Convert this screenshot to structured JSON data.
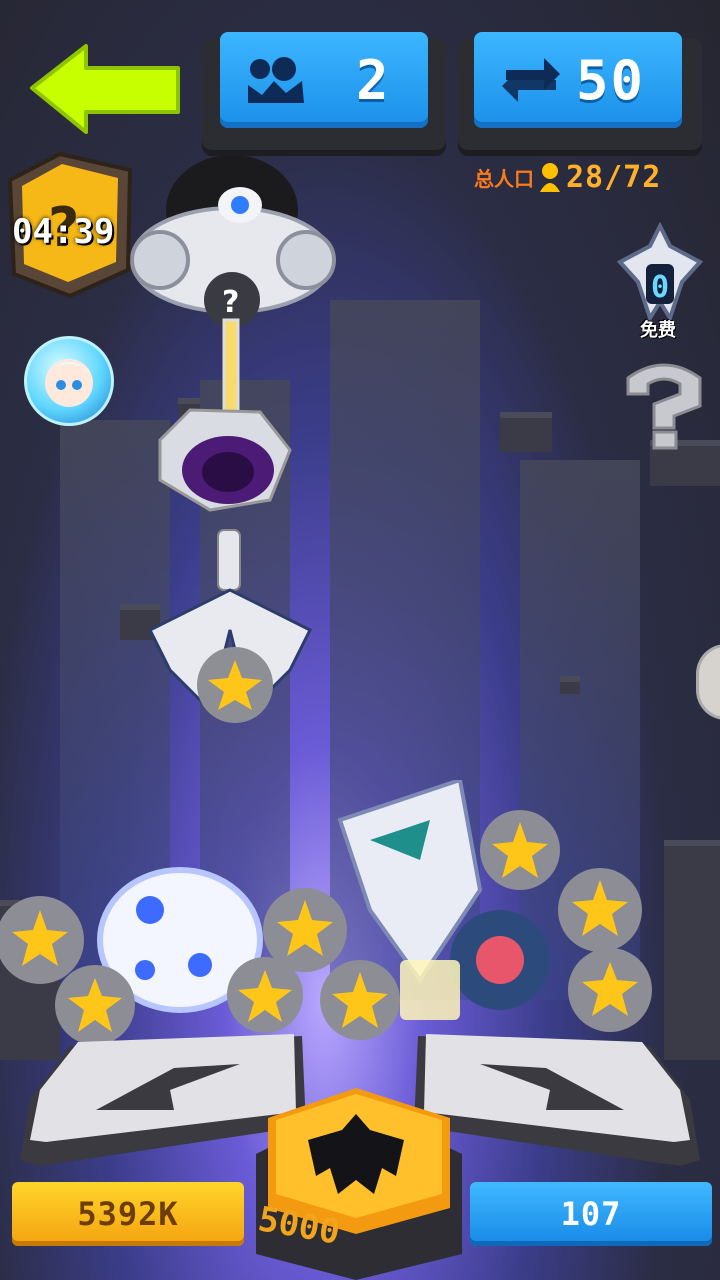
{
  "header": {
    "back_icon": "arrow-left-icon",
    "cats": {
      "icon": "paw-icon",
      "value": "2"
    },
    "refresh": {
      "icon": "swap-arrows-icon",
      "value": "50"
    }
  },
  "population": {
    "label": "总人口",
    "icon": "person-icon",
    "value": "28/72"
  },
  "event": {
    "icon": "mystery-box-icon",
    "timer": "04:39"
  },
  "free_claw": {
    "count": "0",
    "label": "免费"
  },
  "controls": {
    "left_icon": "chevron-left-icon",
    "right_icon": "chevron-right-icon",
    "claw_icon": "claw-icon",
    "claw_cost": "5000",
    "gold_amount": "5392K",
    "gem_amount": "107"
  },
  "colors": {
    "accent_blue": "#1a8fe9",
    "back_arrow": "#c8ff00",
    "gold": "#ffb12a",
    "orange_label": "#ff7a1a"
  }
}
